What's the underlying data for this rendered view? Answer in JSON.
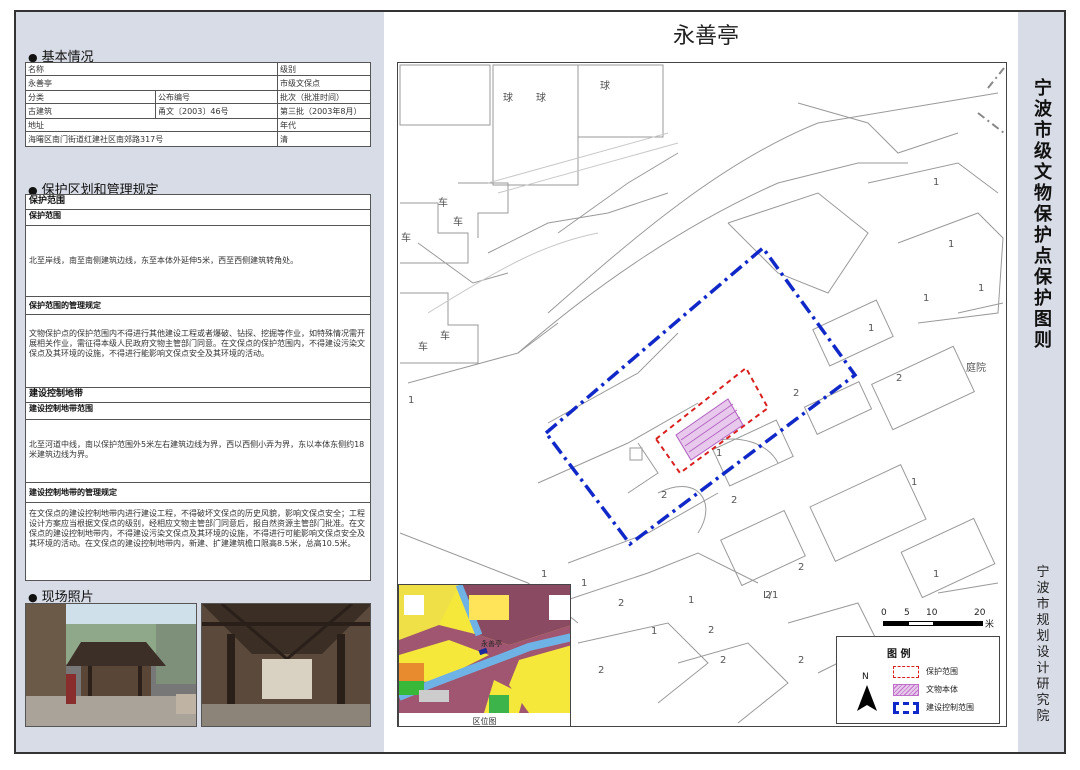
{
  "map_title": "永善亭",
  "vertical_title": "宁波市级文物保护点保护图则",
  "vertical_org": "宁波市规划设计研究院",
  "basic": {
    "heading": "基本情况",
    "name_label": "名称",
    "name": "永善亭",
    "level_label": "级别",
    "level": "市级文保点",
    "category_label": "分类",
    "category": "古建筑",
    "doc_label": "公布编号",
    "doc": "甬文〔2003〕46号",
    "batch_label": "批次（批准时间）",
    "batch": "第三批（2003年8月）",
    "address_label": "地址",
    "address": "海曙区南门街道红建社区南郊路317号",
    "era_label": "年代",
    "era": "清"
  },
  "rules": {
    "heading": "保护区划和管理规定",
    "protect_title": "保护范围",
    "protect_range_label": "保护范围",
    "protect_range": "北至岸线，南至南侧建筑边线，东至本体外延伸5米，西至西侧建筑转角处。",
    "protect_mgmt_label": "保护范围的管理规定",
    "protect_mgmt": "文物保护点的保护范围内不得进行其他建设工程或者爆破、钻探、挖掘等作业，如特殊情况需开展相关作业，需征得本级人民政府文物主管部门同意。在文保点的保护范围内，不得建设污染文保点及其环境的设施，不得进行能影响文保点安全及其环境的活动。",
    "control_title": "建设控制地带",
    "control_range_label": "建设控制地带范围",
    "control_range": "北至河道中线，南以保护范围外5米左右建筑边线为界，西以西侧小弄为界，东以本体东侧约18米建筑边线为界。",
    "control_mgmt_label": "建设控制地带的管理规定",
    "control_mgmt": "在文保点的建设控制地带内进行建设工程，不得破坏文保点的历史风貌，影响文保点安全；工程设计方案应当根据文保点的级别，经相应文物主管部门同意后，报自然资源主管部门批准。在文保点的建设控制地带内，不得建设污染文保点及其环境的设施，不得进行可能影响文保点安全及其环境的活动。在文保点的建设控制地带内，新建、扩建建筑檐口限高8.5米，总高10.5米。"
  },
  "photos_heading": "现场照片",
  "map_labels": {
    "ball": "球",
    "car": "车",
    "courtyard": "庭院",
    "site_tag": "永善亭",
    "inset_caption": "区位图",
    "number_1": "1",
    "number_2": "2",
    "l_label": "L/1"
  },
  "scale": {
    "ticks": [
      "0",
      "5",
      "10",
      "20"
    ],
    "unit": "米"
  },
  "legend": {
    "title": "图 例",
    "north": "N",
    "items": [
      {
        "label": "保护范围",
        "color": "#d82020"
      },
      {
        "label": "文物本体",
        "color": "#c070c8"
      },
      {
        "label": "建设控制范围",
        "color": "#1028c8"
      }
    ]
  }
}
